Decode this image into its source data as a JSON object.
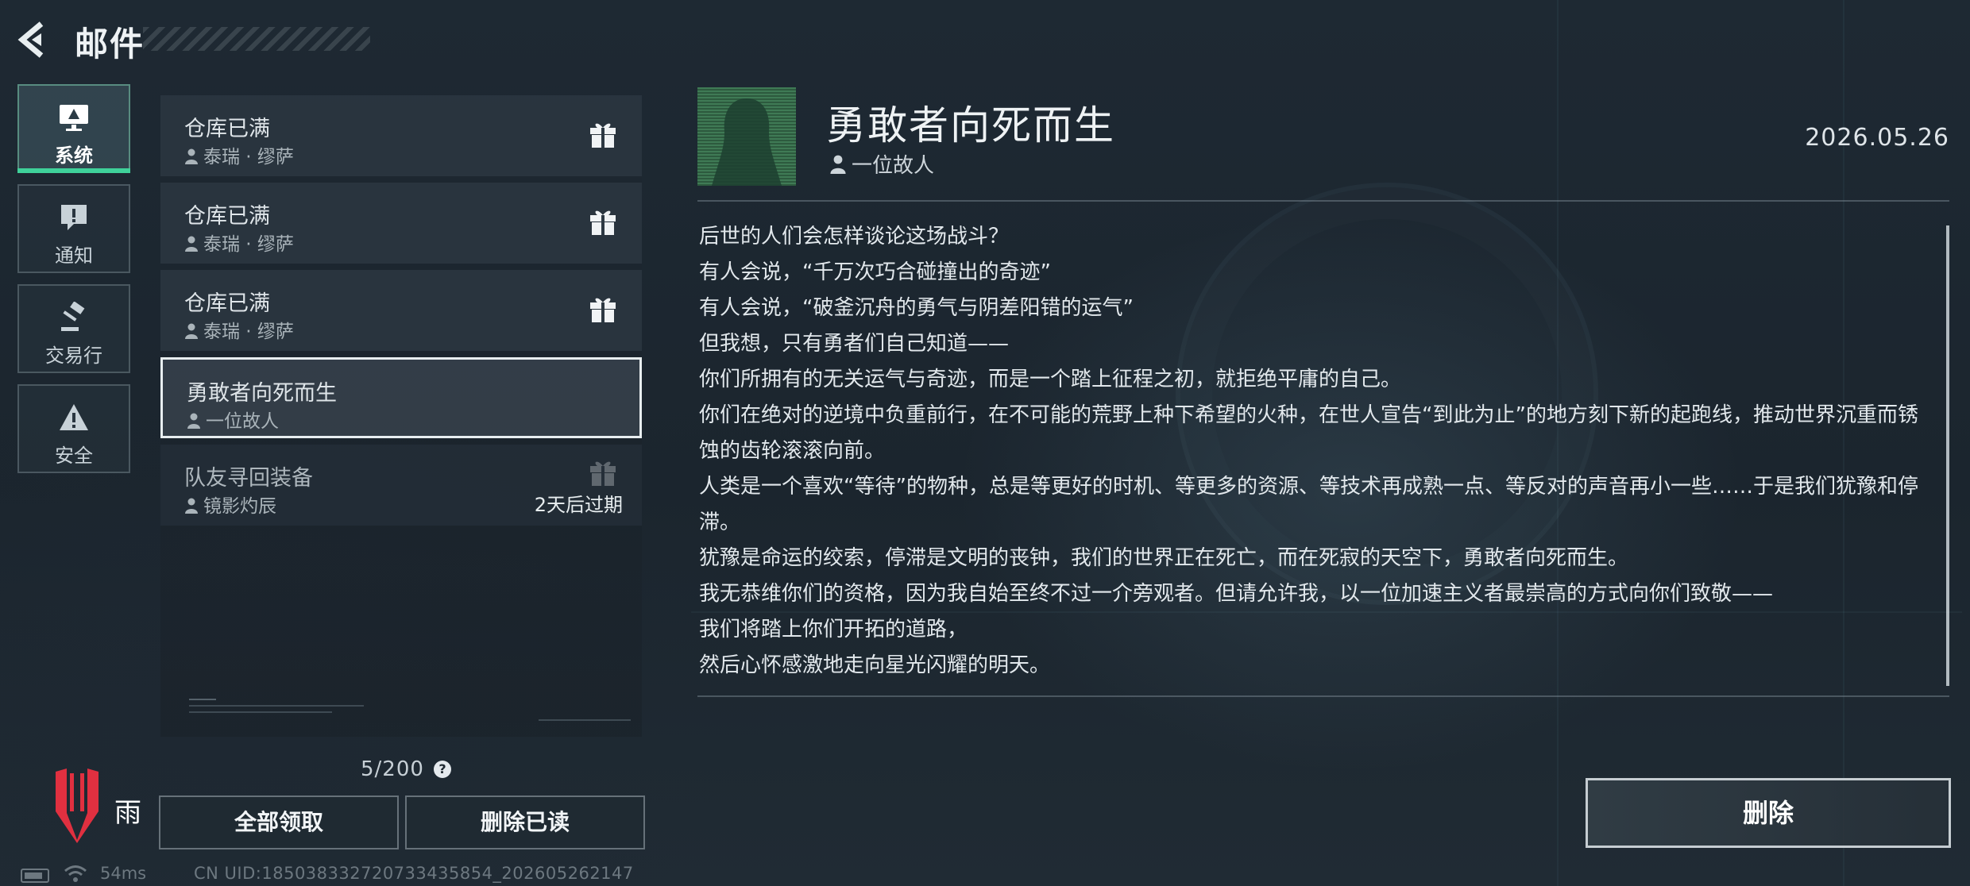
{
  "header": {
    "title": "邮件"
  },
  "categories": [
    {
      "label": "系统",
      "icon": "monitor-icon",
      "active": true
    },
    {
      "label": "通知",
      "icon": "alert-message-icon"
    },
    {
      "label": "交易行",
      "icon": "gavel-icon"
    },
    {
      "label": "安全",
      "icon": "warning-icon"
    }
  ],
  "mails": [
    {
      "subject": "仓库已满",
      "sender": "泰瑞 · 缪萨",
      "icon": "gift-icon"
    },
    {
      "subject": "仓库已满",
      "sender": "泰瑞 · 缪萨",
      "icon": "gift-icon"
    },
    {
      "subject": "仓库已满",
      "sender": "泰瑞 · 缪萨",
      "icon": "gift-icon"
    },
    {
      "subject": "勇敢者向死而生",
      "sender": "一位故人",
      "selected": true
    },
    {
      "subject": "队友寻回装备",
      "sender": "镜影灼辰",
      "icon": "gift-icon",
      "expire": "2天后过期"
    }
  ],
  "list": {
    "count": "5/200",
    "help": "?",
    "claim_all": "全部领取",
    "delete_read": "删除已读"
  },
  "brand": {
    "text": "雨"
  },
  "status": {
    "ping": "54ms",
    "uid": "CN UID:18503833272073343585​4_202605262147"
  },
  "detail": {
    "title": "勇敢者向死而生",
    "sender": "一位故人",
    "date": "2026.05.26",
    "lines": [
      "后世的人们会怎样谈论这场战斗？",
      "有人会说，“千万次巧合碰撞出的奇迹”",
      "有人会说，“破釜沉舟的勇气与阴差阳错的运气”",
      "但我想，只有勇者们自己知道——",
      "你们所拥有的无关运气与奇迹，而是一个踏上征程之初，就拒绝平庸的自己。",
      "你们在绝对的逆境中负重前行，在不可能的荒野上种下希望的火种，在世人宣告“到此为止”的地方刻下新的起跑线，推动世界沉重而锈蚀的齿轮滚滚向前。",
      "人类是一个喜欢“等待”的物种，总是等更好的时机、等更多的资源、等技术再成熟一点、等反对的声音再小一些……于是我们犹豫和停滞。",
      "犹豫是命运的绞索，停滞是文明的丧钟，我们的世界正在死亡，而在死寂的天空下，勇敢者向死而生。",
      "我无恭维你们的资格，因为我自始至终不过一介旁观者。但请允许我，以一位加速主义者最崇高的方式向你们致敬——",
      "我们将踏上你们开拓的道路，",
      "然后心怀感激地走向星光闪耀的明天。"
    ],
    "delete": "删除"
  }
}
